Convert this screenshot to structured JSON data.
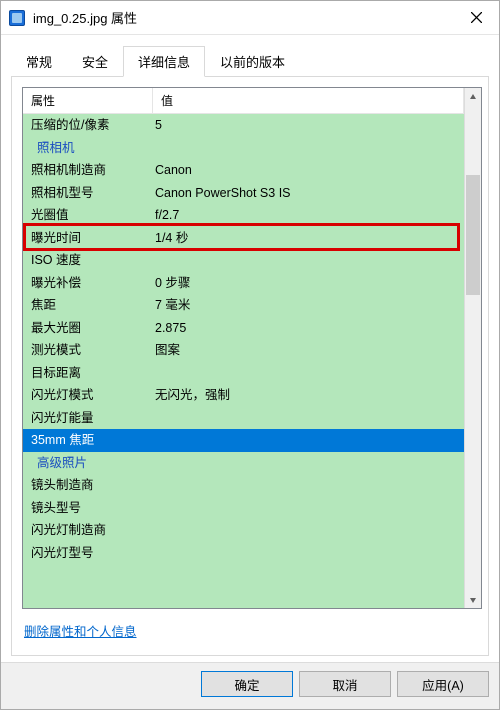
{
  "titlebar": {
    "title": "img_0.25.jpg 属性"
  },
  "tabs": [
    {
      "label": "常规",
      "active": false
    },
    {
      "label": "安全",
      "active": false
    },
    {
      "label": "详细信息",
      "active": true
    },
    {
      "label": "以前的版本",
      "active": false
    }
  ],
  "table": {
    "header_prop": "属性",
    "header_val": "值",
    "rows": [
      {
        "prop": "压缩的位/像素",
        "val": "5"
      },
      {
        "prop": "照相机",
        "val": "",
        "section": true
      },
      {
        "prop": "照相机制造商",
        "val": "Canon"
      },
      {
        "prop": "照相机型号",
        "val": "Canon PowerShot S3 IS"
      },
      {
        "prop": "光圈值",
        "val": "f/2.7"
      },
      {
        "prop": "曝光时间",
        "val": "1/4 秒",
        "highlight": true
      },
      {
        "prop": "ISO 速度",
        "val": ""
      },
      {
        "prop": "曝光补偿",
        "val": "0 步骤"
      },
      {
        "prop": "焦距",
        "val": "7 毫米"
      },
      {
        "prop": "最大光圈",
        "val": "2.875"
      },
      {
        "prop": "测光模式",
        "val": "图案"
      },
      {
        "prop": "目标距离",
        "val": ""
      },
      {
        "prop": "闪光灯模式",
        "val": "无闪光，强制"
      },
      {
        "prop": "闪光灯能量",
        "val": ""
      },
      {
        "prop": "35mm 焦距",
        "val": "",
        "selected": true
      },
      {
        "prop": "高级照片",
        "val": "",
        "section": true
      },
      {
        "prop": "镜头制造商",
        "val": ""
      },
      {
        "prop": "镜头型号",
        "val": ""
      },
      {
        "prop": "闪光灯制造商",
        "val": ""
      },
      {
        "prop": "闪光灯型号",
        "val": ""
      }
    ]
  },
  "link": {
    "text": "删除属性和个人信息"
  },
  "buttons": {
    "ok": "确定",
    "cancel": "取消",
    "apply": "应用(A)"
  }
}
